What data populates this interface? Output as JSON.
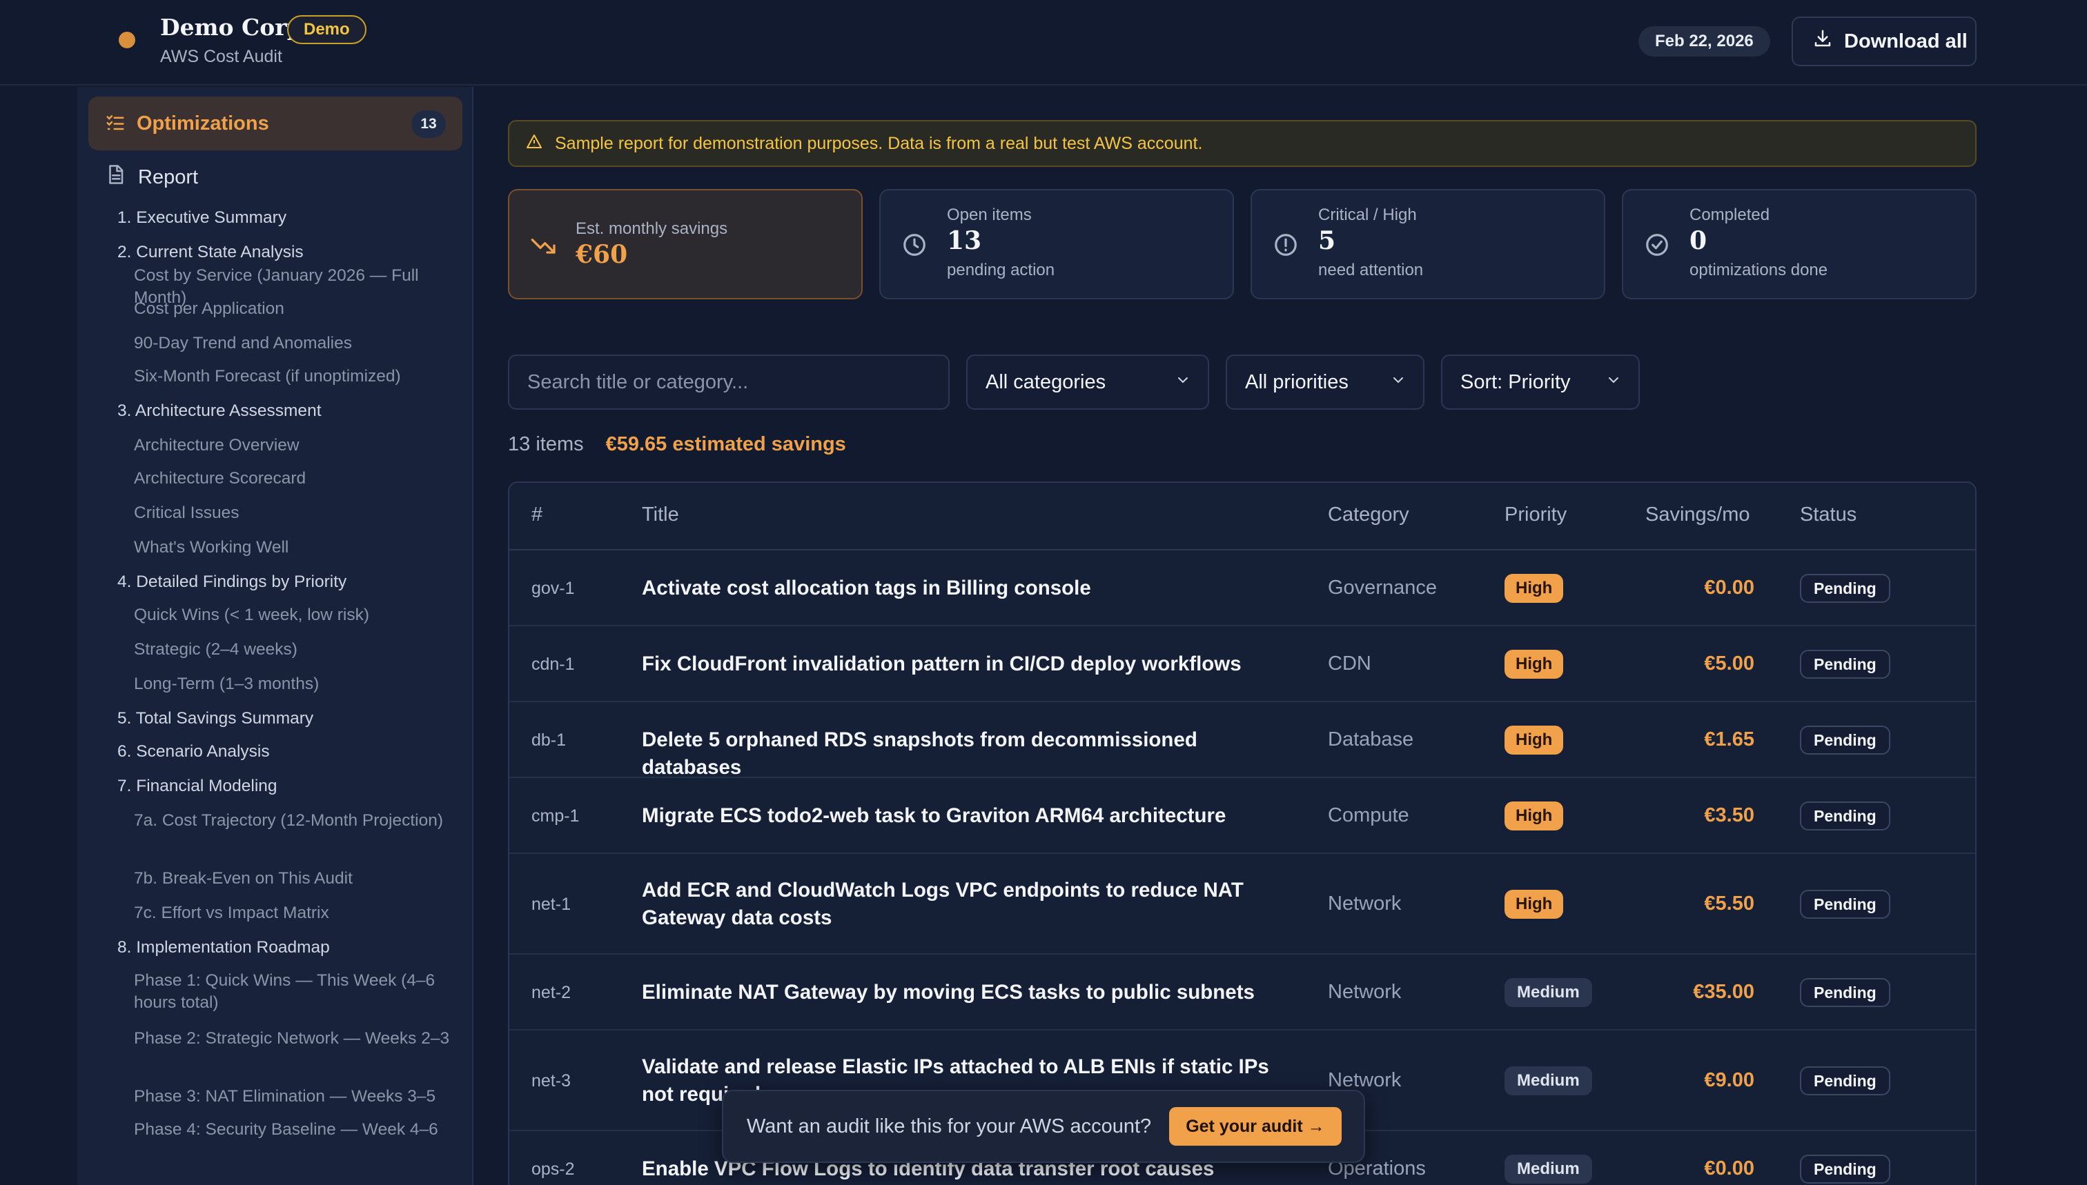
{
  "header": {
    "brand_name": "Demo Corp",
    "badge": "Demo",
    "subtitle": "AWS Cost Audit",
    "date": "Feb 22, 2026",
    "download_label": "Download all"
  },
  "sidebar": {
    "optimizations_label": "Optimizations",
    "optimizations_count": "13",
    "report_label": "Report",
    "toc": [
      {
        "level": 1,
        "label": "1. Executive Summary"
      },
      {
        "level": 1,
        "label": "2. Current State Analysis"
      },
      {
        "level": 2,
        "label": "Cost by Service (January 2026 — Full Month)"
      },
      {
        "level": 2,
        "label": "Cost per Application"
      },
      {
        "level": 2,
        "label": "90-Day Trend and Anomalies"
      },
      {
        "level": 2,
        "label": "Six-Month Forecast (if unoptimized)"
      },
      {
        "level": 1,
        "label": "3. Architecture Assessment"
      },
      {
        "level": 2,
        "label": "Architecture Overview"
      },
      {
        "level": 2,
        "label": "Architecture Scorecard"
      },
      {
        "level": 2,
        "label": "Critical Issues"
      },
      {
        "level": 2,
        "label": "What's Working Well"
      },
      {
        "level": 1,
        "label": "4. Detailed Findings by Priority"
      },
      {
        "level": 2,
        "label": "Quick Wins (< 1 week, low risk)"
      },
      {
        "level": 2,
        "label": "Strategic (2–4 weeks)"
      },
      {
        "level": 2,
        "label": "Long-Term (1–3 months)"
      },
      {
        "level": 1,
        "label": "5. Total Savings Summary"
      },
      {
        "level": 1,
        "label": "6. Scenario Analysis"
      },
      {
        "level": 1,
        "label": "7. Financial Modeling"
      },
      {
        "level": 2,
        "label": "7a. Cost Trajectory (12-Month Projection)"
      },
      {
        "level": 2,
        "label": "7b. Break-Even on This Audit"
      },
      {
        "level": 2,
        "label": "7c. Effort vs Impact Matrix"
      },
      {
        "level": 1,
        "label": "8. Implementation Roadmap"
      },
      {
        "level": 2,
        "label": "Phase 1: Quick Wins — This Week (4–6 hours total)"
      },
      {
        "level": 2,
        "label": "Phase 2: Strategic Network — Weeks 2–3"
      },
      {
        "level": 2,
        "label": "Phase 3: NAT Elimination — Weeks 3–5"
      },
      {
        "level": 2,
        "label": "Phase 4: Security Baseline — Week 4–6"
      }
    ]
  },
  "banner": {
    "icon": "warning-icon",
    "text": "Sample report for demonstration purposes. Data is from a real but test AWS account."
  },
  "stats": [
    {
      "icon": "trending-down-icon",
      "label": "Est. monthly savings",
      "value": "€60",
      "sub": ""
    },
    {
      "icon": "clock-icon",
      "label": "Open items",
      "value": "13",
      "sub": "pending action"
    },
    {
      "icon": "alert-circle-icon",
      "label": "Critical / High",
      "value": "5",
      "sub": "need attention"
    },
    {
      "icon": "check-circle-icon",
      "label": "Completed",
      "value": "0",
      "sub": "optimizations done"
    }
  ],
  "filters": {
    "search_placeholder": "Search title or category...",
    "category": "All categories",
    "priority": "All priorities",
    "sort": "Sort: Priority"
  },
  "summary": {
    "count": "13 items",
    "savings": "€59.65 estimated savings"
  },
  "table": {
    "headers": [
      "#",
      "Title",
      "Category",
      "Priority",
      "Savings/mo",
      "Status"
    ],
    "rows": [
      {
        "id": "gov-1",
        "title": "Activate cost allocation tags in Billing console",
        "category": "Governance",
        "priority": "High",
        "savings": "€0.00",
        "status": "Pending"
      },
      {
        "id": "cdn-1",
        "title": "Fix CloudFront invalidation pattern in CI/CD deploy workflows",
        "category": "CDN",
        "priority": "High",
        "savings": "€5.00",
        "status": "Pending"
      },
      {
        "id": "db-1",
        "title": "Delete 5 orphaned RDS snapshots from decommissioned databases",
        "category": "Database",
        "priority": "High",
        "savings": "€1.65",
        "status": "Pending"
      },
      {
        "id": "cmp-1",
        "title": "Migrate ECS todo2-web task to Graviton ARM64 architecture",
        "category": "Compute",
        "priority": "High",
        "savings": "€3.50",
        "status": "Pending"
      },
      {
        "id": "net-1",
        "title": "Add ECR and CloudWatch Logs VPC endpoints to reduce NAT Gateway data costs",
        "category": "Network",
        "priority": "High",
        "savings": "€5.50",
        "status": "Pending"
      },
      {
        "id": "net-2",
        "title": "Eliminate NAT Gateway by moving ECS tasks to public subnets",
        "category": "Network",
        "priority": "Medium",
        "savings": "€35.00",
        "status": "Pending"
      },
      {
        "id": "net-3",
        "title": "Validate and release Elastic IPs attached to ALB ENIs if static IPs not required",
        "category": "Network",
        "priority": "Medium",
        "savings": "€9.00",
        "status": "Pending"
      },
      {
        "id": "ops-2",
        "title": "Enable VPC Flow Logs to identify data transfer root causes",
        "category": "Operations",
        "priority": "Medium",
        "savings": "€0.00",
        "status": "Pending"
      }
    ]
  },
  "cta": {
    "text": "Want an audit like this for your AWS account?",
    "button": "Get your audit →"
  },
  "colors": {
    "background": "#111a2e",
    "accent": "#f0a14a",
    "warning": "#f5c542"
  }
}
